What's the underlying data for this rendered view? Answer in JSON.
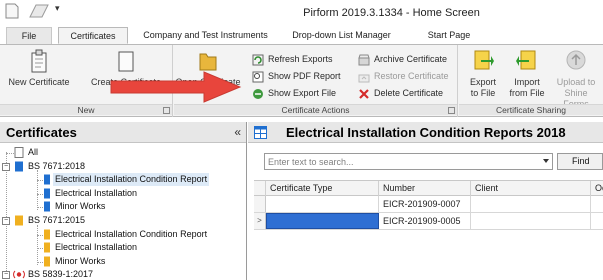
{
  "window": {
    "title": "Pirform 2019.3.1334 - Home Screen",
    "dropdown_glyph": "▾"
  },
  "ribbon_tabs": [
    {
      "label": "File"
    },
    {
      "label": "Certificates"
    },
    {
      "label": "Company and Test Instruments"
    },
    {
      "label": "Drop-down List Manager"
    },
    {
      "label": "Start Page"
    }
  ],
  "ribbon": {
    "new_group": {
      "label": "New",
      "new_certificate": "New Certificate",
      "create_certificate": "Create Certificate"
    },
    "actions_group": {
      "label": "Certificate Actions",
      "open_certificate": "Open Certificate",
      "refresh_exports": "Refresh Exports",
      "show_pdf_report": "Show PDF Report",
      "show_export_file": "Show Export File",
      "archive_certificate": "Archive Certificate",
      "restore_certificate": "Restore Certificate",
      "delete_certificate": "Delete Certificate"
    },
    "sharing_group": {
      "label": "Certificate Sharing",
      "export_line1": "Export",
      "export_line2": "to File",
      "import_line1": "Import",
      "import_line2": "from File",
      "upload_line1": "Upload to",
      "upload_line2": "Shine Forms"
    }
  },
  "left_pane": {
    "title": "Certificates",
    "collapse_glyph": "«",
    "tree": [
      {
        "label": "All",
        "level": 0,
        "expander": ""
      },
      {
        "label": "BS 7671:2018",
        "level": 0,
        "expander": "−"
      },
      {
        "label": "Electrical Installation Condition Report",
        "level": 1,
        "selected": true
      },
      {
        "label": "Electrical Installation",
        "level": 1
      },
      {
        "label": "Minor Works",
        "level": 1
      },
      {
        "label": "BS 7671:2015",
        "level": 0,
        "expander": "−"
      },
      {
        "label": "Electrical Installation Condition Report",
        "level": 1
      },
      {
        "label": "Electrical Installation",
        "level": 1
      },
      {
        "label": "Minor Works",
        "level": 1
      },
      {
        "label": "BS 5839-1:2017",
        "level": 0,
        "expander": "−"
      }
    ]
  },
  "right_pane": {
    "title": "Electrical Installation Condition Reports 2018",
    "search_placeholder": "Enter text to search...",
    "find_label": "Find",
    "columns": [
      "Certificate Type",
      "Number",
      "Client",
      "Oc"
    ],
    "rows": [
      {
        "indicator": "",
        "cells": [
          "",
          "EICR-201909-0007",
          "",
          ""
        ]
      },
      {
        "indicator": ">",
        "cells": [
          "",
          "EICR-201909-0005",
          "",
          ""
        ],
        "editing": true
      }
    ]
  },
  "colors": {
    "accent_red": "#e8453c",
    "selection_blue": "#2f6fd3",
    "ribbon_bg": "#f3f3f3"
  }
}
